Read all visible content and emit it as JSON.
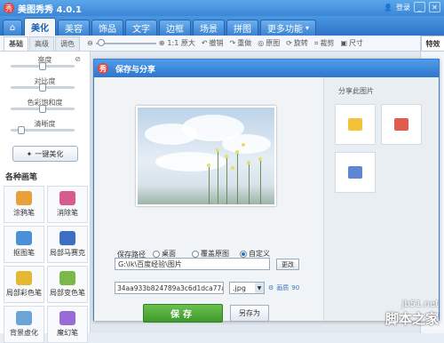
{
  "app": {
    "title": "美图秀秀 4.0.1",
    "login": "登录"
  },
  "tabs": [
    {
      "label": "美化"
    },
    {
      "label": "美容"
    },
    {
      "label": "饰品"
    },
    {
      "label": "文字"
    },
    {
      "label": "边框"
    },
    {
      "label": "场景"
    },
    {
      "label": "拼图"
    },
    {
      "label": "更多功能"
    }
  ],
  "left_tabs": [
    {
      "label": "基础"
    },
    {
      "label": "高级"
    },
    {
      "label": "调色"
    }
  ],
  "toolbar": {
    "actual_size": "1:1 原大",
    "undo": "撤销",
    "redo": "重做",
    "original": "原图",
    "rotate": "旋转",
    "crop": "裁剪",
    "size": "尺寸"
  },
  "sliders": [
    {
      "label": "亮度",
      "value": 0.5
    },
    {
      "label": "对比度",
      "value": 0.5
    },
    {
      "label": "色彩饱和度",
      "value": 0.5
    },
    {
      "label": "清晰度",
      "value": 0.15
    }
  ],
  "one_key": "一键美化",
  "brushes_title": "各种画笔",
  "brushes": [
    {
      "label": "涂鸦笔",
      "color": "#e8a13a"
    },
    {
      "label": "消除笔",
      "color": "#d95a8e"
    },
    {
      "label": "抠图笔",
      "color": "#4a8fd9"
    },
    {
      "label": "局部马赛克",
      "color": "#3f6fc4"
    },
    {
      "label": "局部彩色笔",
      "color": "#e4b830"
    },
    {
      "label": "局部变色笔",
      "color": "#7bb84a"
    },
    {
      "label": "背景虚化",
      "color": "#6aa5d9"
    },
    {
      "label": "魔幻笔",
      "color": "#9a6ad9"
    }
  ],
  "right_tab": "特效",
  "dialog": {
    "title": "保存与分享",
    "save_path_label": "保存路径",
    "radio_desktop": "桌面",
    "radio_overwrite": "覆盖原图",
    "radio_custom": "自定义",
    "path_value": "G:\\lk\\百度经验\\图片",
    "change_button": "更改",
    "filename": "34aa933b824789a3c6d1dca77af27",
    "format": ".jpg",
    "quality_label": "画质",
    "quality_value": "90",
    "save_button": "保存",
    "saveas_button": "另存为",
    "share_title": "分享此图片"
  },
  "watermark": {
    "site": "jb51.net",
    "name": "脚本之家"
  }
}
